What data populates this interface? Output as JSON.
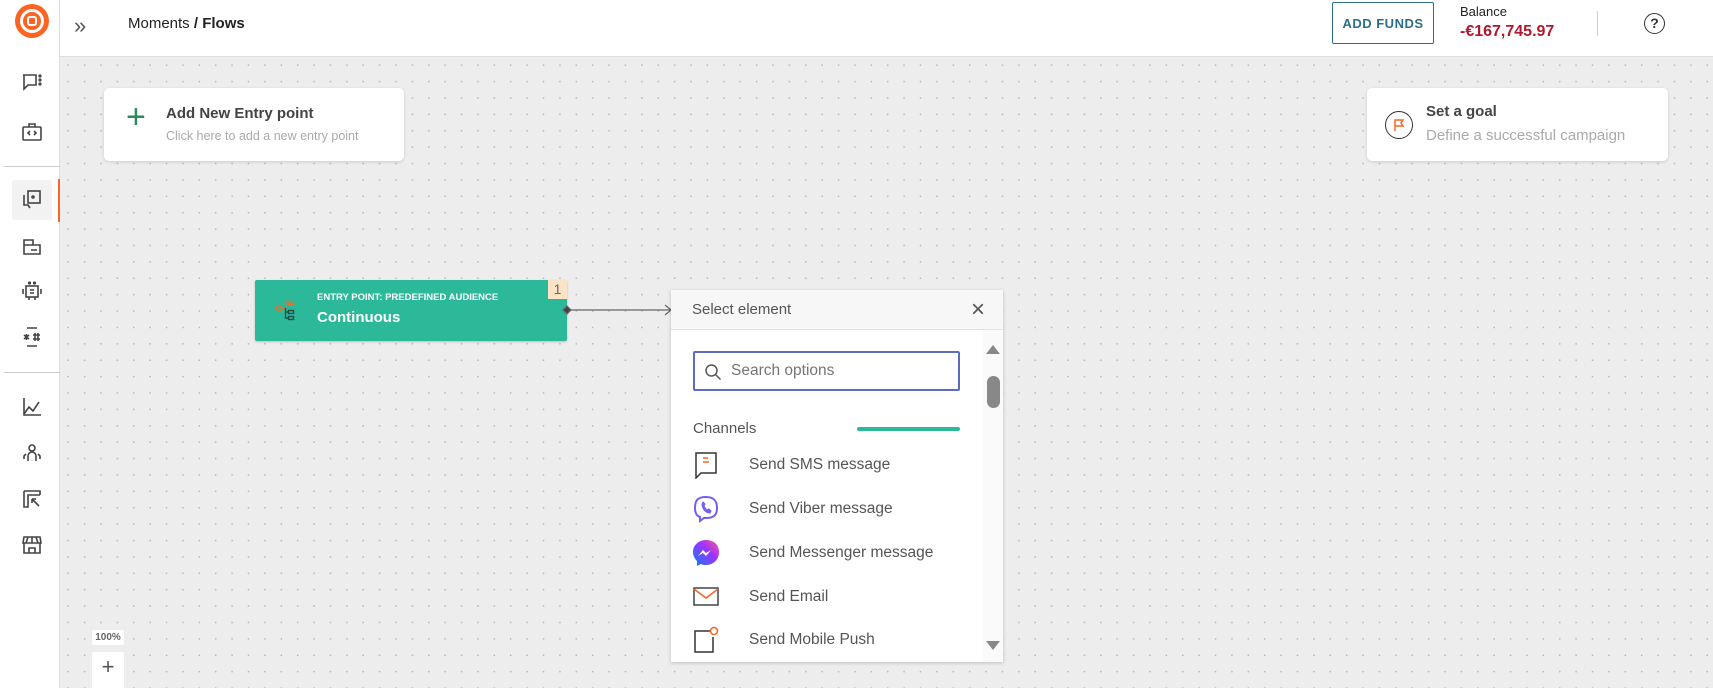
{
  "header": {
    "breadcrumb_parent": "Moments",
    "breadcrumb_sep": " / ",
    "breadcrumb_current": "Flows",
    "add_funds": "ADD FUNDS",
    "balance_label": "Balance",
    "balance_value": "-€167,745.97"
  },
  "sidebar": {
    "items": [
      {
        "icon": "chat-dots-icon"
      },
      {
        "icon": "code-briefcase-icon"
      },
      {
        "icon": "flows-icon",
        "active": true
      },
      {
        "icon": "forms-icon"
      },
      {
        "icon": "bot-icon"
      },
      {
        "icon": "hash-icon"
      },
      {
        "icon": "analytics-icon"
      },
      {
        "icon": "people-icon"
      },
      {
        "icon": "exports-icon"
      },
      {
        "icon": "store-icon"
      }
    ]
  },
  "canvas": {
    "add_entry": {
      "title": "Add New Entry point",
      "subtitle": "Click here to add a new entry point"
    },
    "goal": {
      "title": "Set a goal",
      "subtitle": "Define a successful campaign"
    },
    "entry_node": {
      "label": "ENTRY POINT: PREDEFINED AUDIENCE",
      "value": "Continuous",
      "badge": "1",
      "color": "#2bb999"
    },
    "zoom_level": "100%",
    "zoom_in": "+"
  },
  "panel": {
    "title": "Select element",
    "search_placeholder": "Search options",
    "section": "Channels",
    "items": [
      {
        "label": "Send SMS message",
        "icon": "sms-icon"
      },
      {
        "label": "Send Viber message",
        "icon": "viber-icon"
      },
      {
        "label": "Send Messenger message",
        "icon": "messenger-icon"
      },
      {
        "label": "Send Email",
        "icon": "email-icon"
      },
      {
        "label": "Send Mobile Push",
        "icon": "mobile-push-icon"
      }
    ]
  },
  "colors": {
    "brand": "#fc6423",
    "balance": "#b0182b",
    "accent": "#2bb999",
    "button_border": "#2c6e8a"
  }
}
